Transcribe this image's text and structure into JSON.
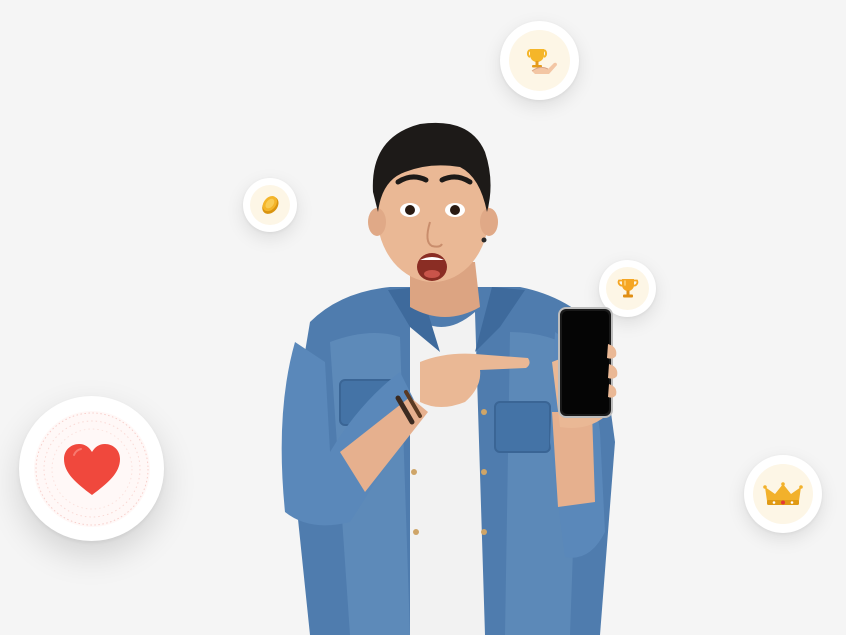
{
  "scene": {
    "background_color": "#f5f5f5",
    "subject": "man-pointing-at-phone",
    "badges": [
      {
        "icon": "trophy-hand-icon",
        "accent": "#f5b629"
      },
      {
        "icon": "coin-icon",
        "accent": "#f2b12b"
      },
      {
        "icon": "trophy-icon",
        "accent": "#f5a623"
      },
      {
        "icon": "heart-icon",
        "accent": "#f0483d"
      },
      {
        "icon": "crown-icon",
        "accent": "#f2b12b"
      }
    ]
  }
}
